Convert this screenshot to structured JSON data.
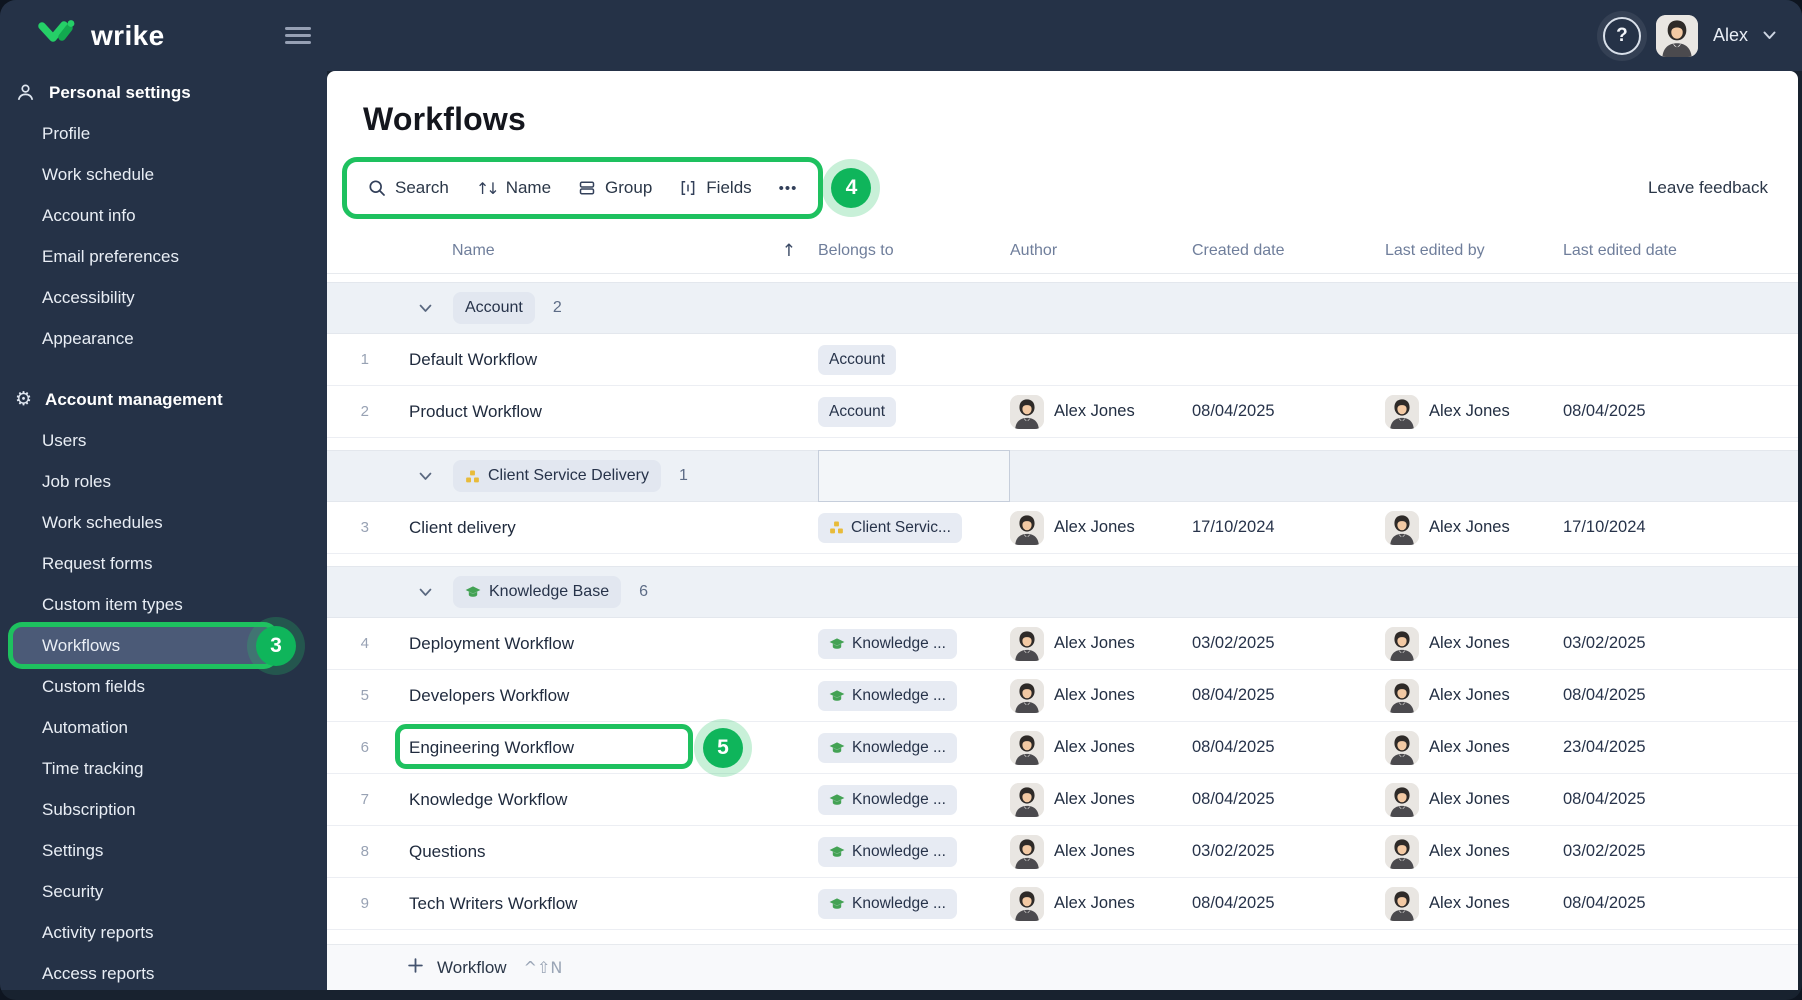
{
  "topbar": {
    "brand": "wrike",
    "user": "Alex",
    "help_label": "?"
  },
  "annotations": {
    "sidebar_badge": "3",
    "toolbar_badge": "4",
    "row_badge": "5",
    "accent_color": "#1ec15f"
  },
  "sidebar": {
    "selected": "Workflows",
    "sections": [
      {
        "label": "Personal settings",
        "icon": "person",
        "items": [
          "Profile",
          "Work schedule",
          "Account info",
          "Email preferences",
          "Accessibility",
          "Appearance"
        ]
      },
      {
        "label": "Account management",
        "icon": "gear",
        "items": [
          "Users",
          "Job roles",
          "Work schedules",
          "Request forms",
          "Custom item types",
          "Workflows",
          "Custom fields",
          "Automation",
          "Time tracking",
          "Subscription",
          "Settings",
          "Security",
          "Activity reports",
          "Access reports"
        ]
      }
    ]
  },
  "page": {
    "title": "Workflows",
    "leave_feedback": "Leave feedback"
  },
  "toolbar": {
    "items": [
      {
        "icon": "search",
        "label": "Search"
      },
      {
        "icon": "sort",
        "label": "Name"
      },
      {
        "icon": "group",
        "label": "Group"
      },
      {
        "icon": "fields",
        "label": "Fields"
      },
      {
        "icon": "more",
        "label": ""
      }
    ]
  },
  "table": {
    "columns": [
      "Name",
      "Belongs to",
      "Author",
      "Created date",
      "Last edited by",
      "Last edited date"
    ],
    "sort_column": "Name",
    "sort_arrow": "↑",
    "groups": [
      {
        "label": "Account",
        "icon": null,
        "count": "2",
        "focus_cell": false,
        "rows": [
          {
            "num": "1",
            "name": "Default Workflow",
            "belongs": "Account",
            "belongs_icon": null,
            "author": null,
            "created": "",
            "edited_by": null,
            "edited": ""
          },
          {
            "num": "2",
            "name": "Product Workflow",
            "belongs": "Account",
            "belongs_icon": null,
            "author": "Alex Jones",
            "created": "08/04/2025",
            "edited_by": "Alex Jones",
            "edited": "08/04/2025"
          }
        ]
      },
      {
        "label": "Client Service Delivery",
        "icon": "org",
        "count": "1",
        "focus_cell": true,
        "rows": [
          {
            "num": "3",
            "name": "Client delivery",
            "belongs": "Client Servic...",
            "belongs_icon": "org",
            "author": "Alex Jones",
            "created": "17/10/2024",
            "edited_by": "Alex Jones",
            "edited": "17/10/2024"
          }
        ]
      },
      {
        "label": "Knowledge Base",
        "icon": "cap",
        "count": "6",
        "focus_cell": false,
        "rows": [
          {
            "num": "4",
            "name": "Deployment Workflow",
            "belongs": "Knowledge ...",
            "belongs_icon": "cap",
            "author": "Alex Jones",
            "created": "03/02/2025",
            "edited_by": "Alex Jones",
            "edited": "03/02/2025"
          },
          {
            "num": "5",
            "name": "Developers Workflow",
            "belongs": "Knowledge ...",
            "belongs_icon": "cap",
            "author": "Alex Jones",
            "created": "08/04/2025",
            "edited_by": "Alex Jones",
            "edited": "08/04/2025"
          },
          {
            "num": "6",
            "name": "Engineering Workflow",
            "belongs": "Knowledge ...",
            "belongs_icon": "cap",
            "author": "Alex Jones",
            "created": "08/04/2025",
            "edited_by": "Alex Jones",
            "edited": "23/04/2025",
            "annotated": true
          },
          {
            "num": "7",
            "name": "Knowledge Workflow",
            "belongs": "Knowledge ...",
            "belongs_icon": "cap",
            "author": "Alex Jones",
            "created": "08/04/2025",
            "edited_by": "Alex Jones",
            "edited": "08/04/2025"
          },
          {
            "num": "8",
            "name": "Questions",
            "belongs": "Knowledge ...",
            "belongs_icon": "cap",
            "author": "Alex Jones",
            "created": "03/02/2025",
            "edited_by": "Alex Jones",
            "edited": "03/02/2025"
          },
          {
            "num": "9",
            "name": "Tech Writers Workflow",
            "belongs": "Knowledge ...",
            "belongs_icon": "cap",
            "author": "Alex Jones",
            "created": "08/04/2025",
            "edited_by": "Alex Jones",
            "edited": "08/04/2025"
          }
        ]
      }
    ]
  },
  "footer": {
    "add_label": "Workflow",
    "shortcut": "^⇧N"
  }
}
